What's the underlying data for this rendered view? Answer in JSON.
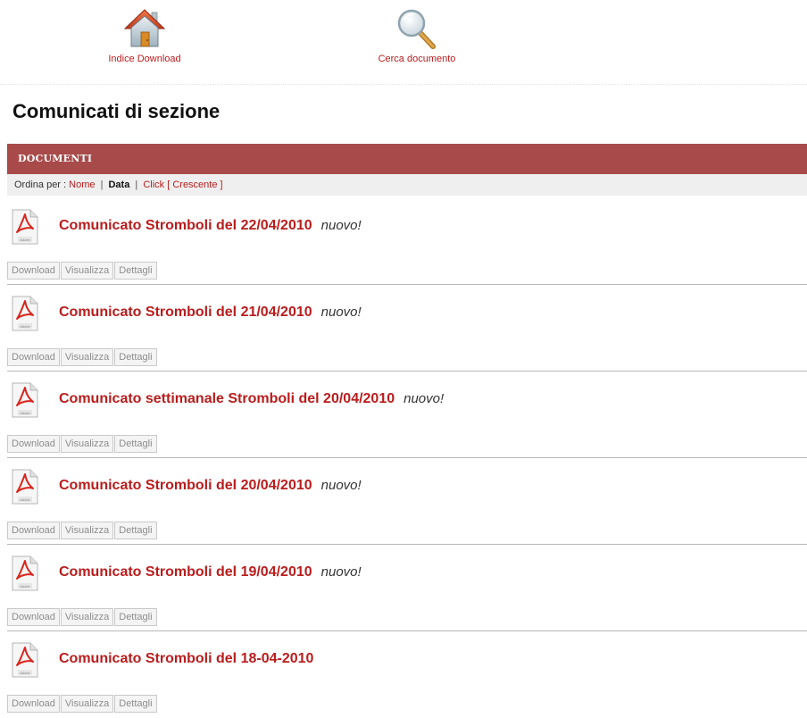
{
  "nav": {
    "home_label": "Indice Download",
    "search_label": "Cerca documento"
  },
  "page": {
    "title": "Comunicati di sezione"
  },
  "section": {
    "header": "DOCUMENTI"
  },
  "sort": {
    "prefix": "Ordina per :",
    "name": "Nome",
    "separator": "|",
    "date": "Data",
    "clicks": "Click",
    "order": "[ Crescente ]"
  },
  "documents": [
    {
      "title": "Comunicato Stromboli del 22/04/2010",
      "badge": "nuovo!"
    },
    {
      "title": "Comunicato Stromboli del 21/04/2010",
      "badge": "nuovo!"
    },
    {
      "title": "Comunicato settimanale Stromboli del 20/04/2010",
      "badge": "nuovo!"
    },
    {
      "title": "Comunicato Stromboli del 20/04/2010",
      "badge": "nuovo!"
    },
    {
      "title": "Comunicato Stromboli del 19/04/2010",
      "badge": "nuovo!"
    },
    {
      "title": "Comunicato Stromboli del 18-04-2010",
      "badge": ""
    }
  ],
  "buttons": {
    "download": "Download",
    "view": "Visualizza",
    "details": "Dettagli"
  },
  "icons": {
    "home": "home-icon",
    "search": "magnifier-icon",
    "document": "pdf-icon"
  },
  "colors": {
    "accent": "#b91d1d",
    "header_bar": "#a84a4a",
    "sort_bar": "#efefef"
  }
}
